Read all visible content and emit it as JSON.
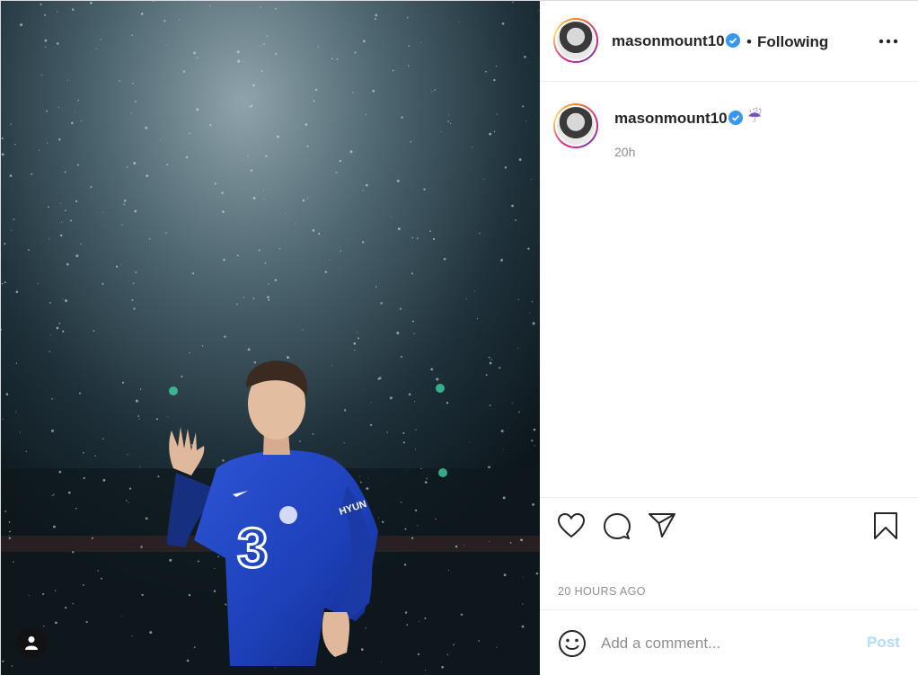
{
  "header": {
    "username": "masonmount10",
    "separator": "•",
    "follow_status": "Following"
  },
  "caption": {
    "username": "masonmount10",
    "emoji": "☔",
    "time": "20h"
  },
  "actions": {
    "timestamp": "20 HOURS AGO"
  },
  "comment": {
    "placeholder": "Add a comment...",
    "post_label": "Post"
  },
  "media": {
    "shirt_sponsor": "3",
    "sleeve_text": "HYUN"
  },
  "colors": {
    "verified": "#3897f0",
    "post_button_disabled": "#b3dbff",
    "jersey_blue": "#1d3fb8"
  }
}
